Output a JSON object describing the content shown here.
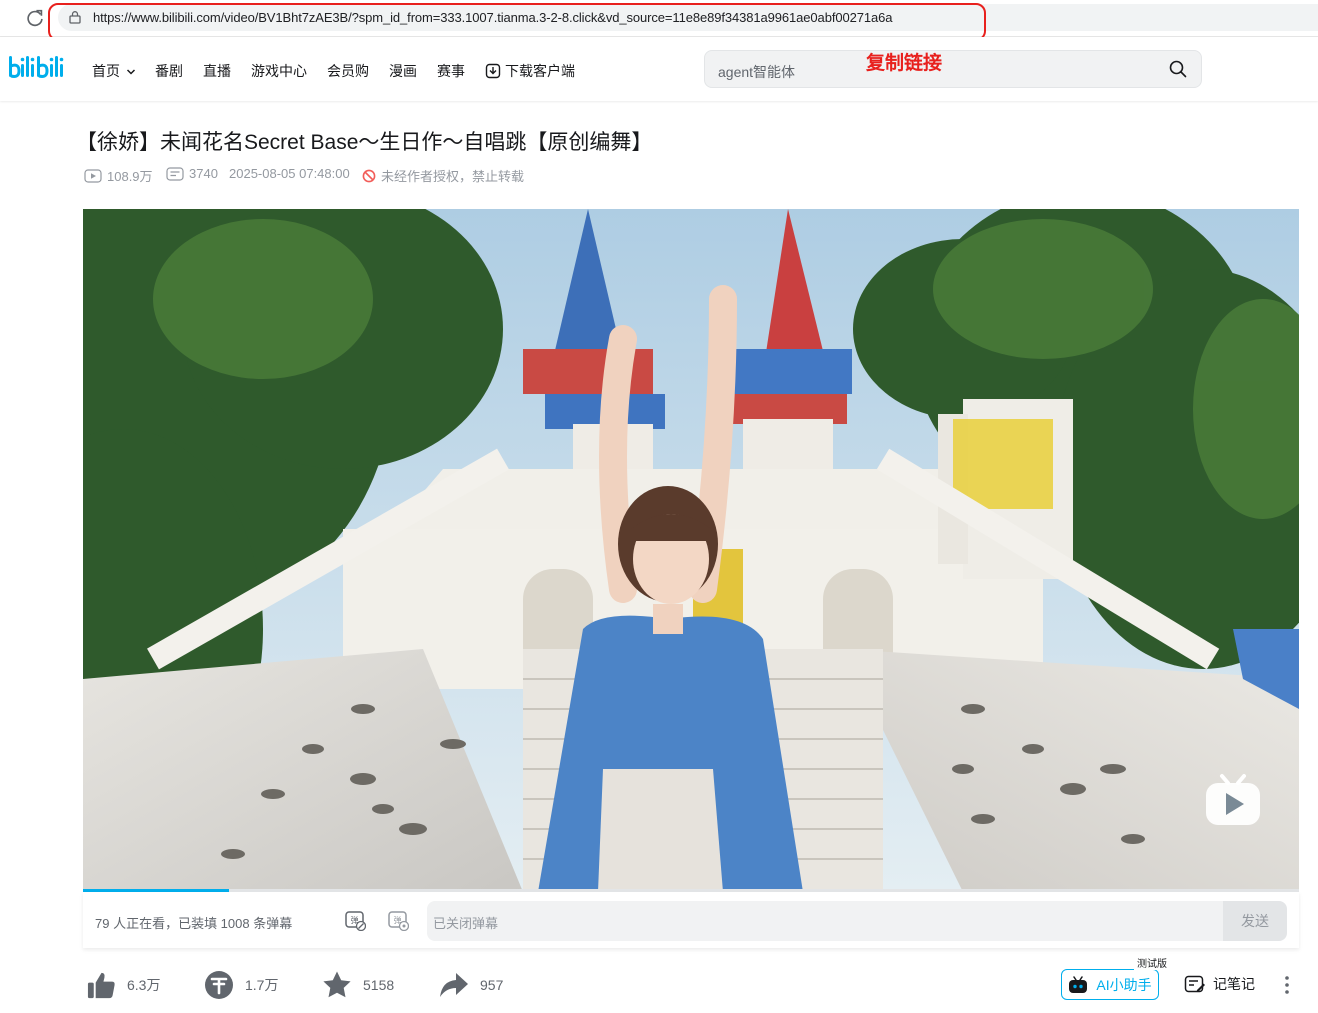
{
  "browser": {
    "url": "https://www.bilibili.com/video/BV1Bht7zAE3B/?spm_id_from=333.1007.tianma.3-2-8.click&vd_source=11e8e89f34381a9961ae0abf00271a6a"
  },
  "annotation": {
    "text": "复制链接",
    "color": "#e8201d"
  },
  "header": {
    "logo": "bilibili",
    "nav": [
      {
        "label": "首页"
      },
      {
        "label": "番剧"
      },
      {
        "label": "直播"
      },
      {
        "label": "游戏中心"
      },
      {
        "label": "会员购"
      },
      {
        "label": "漫画"
      },
      {
        "label": "赛事"
      },
      {
        "label": "下载客户端"
      }
    ],
    "search_placeholder": "agent智能体"
  },
  "video": {
    "title": "【徐娇】未闻花名Secret Base～生日作～自唱跳【原创编舞】",
    "views": "108.9万",
    "danmaku_count": "3740",
    "date": "2025-08-05 07:48:00",
    "copyright_notice": "未经作者授权，禁止转载",
    "progress_fraction": 0.12
  },
  "danmaku_bar": {
    "viewers": "79 人正在看，已装填 1008 条弹幕",
    "input_placeholder": "已关闭弹幕",
    "send_label": "发送"
  },
  "actions": {
    "like": "6.3万",
    "coin": "1.7万",
    "favorite": "5158",
    "share": "957",
    "ai_label": "AI小助手",
    "ai_badge": "测试版",
    "notes_label": "记笔记"
  },
  "colors": {
    "brand": "#00aeec",
    "annotation": "#e8201d"
  }
}
